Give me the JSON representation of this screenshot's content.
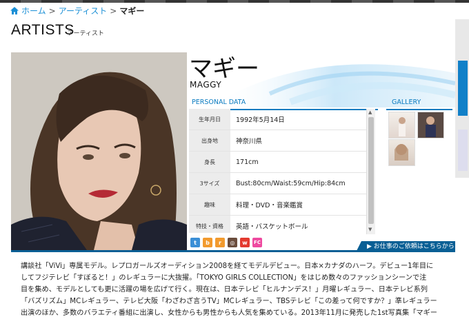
{
  "breadcrumb": {
    "home_label": "ホーム",
    "sep1": ">",
    "artist_label": "アーティスト",
    "sep2": ">",
    "current_label": "マギー"
  },
  "page": {
    "title": "ARTISTS",
    "subtitle": "アーティスト"
  },
  "artist": {
    "name_ja": "マギー",
    "name_en": "MAGGY"
  },
  "personal_data": {
    "heading": "PERSONAL DATA",
    "rows": [
      {
        "label": "生年月日",
        "value": "1992年5月14日"
      },
      {
        "label": "出身地",
        "value": "神奈川県"
      },
      {
        "label": "身長",
        "value": "171cm"
      },
      {
        "label": "3サイズ",
        "value": "Bust:80cm/Waist:59cm/Hip:84cm"
      },
      {
        "label": "趣味",
        "value": "料理・DVD・音楽鑑賞"
      },
      {
        "label": "特技・資格",
        "value": "英語・バスケットボール"
      }
    ]
  },
  "gallery": {
    "heading": "GALLERY",
    "thumbnails": [
      "gallery-thumb-1",
      "gallery-thumb-2",
      "gallery-thumb-3"
    ]
  },
  "social_icons": [
    {
      "name": "twitter-icon",
      "glyph": "t",
      "color": "#3b8fd6"
    },
    {
      "name": "blog-icon",
      "glyph": "b",
      "color": "#f29a2e"
    },
    {
      "name": "rss-icon",
      "glyph": "r",
      "color": "#f29a2e"
    },
    {
      "name": "instagram-icon",
      "glyph": "◎",
      "color": "#6b4d3d"
    },
    {
      "name": "weibo-icon",
      "glyph": "w",
      "color": "#e33a2f"
    },
    {
      "name": "fc-icon",
      "glyph": "FC",
      "color": "#ee4aa0"
    }
  ],
  "contact_link": {
    "label": "▶ お仕事のご依頼はこちらから"
  },
  "bio": {
    "lines": [
      "講談社「ViVi」専属モデル。レプロガールズオーディション2008を経てモデルデビュー。日本×カナダのハーフ。デビュー1年目に",
      "してフジテレビ「すぼると！」のレギュラーに大抜擢。「TOKYO GIRLS COLLECTION」をはじめ数々のファッションシーンで注",
      "目を集め、モデルとしても更に活躍の場を広げて行く。現在は、日本テレビ「ヒルナンデス！」月曜レギュラー、日本テレビ系列",
      "「バズリズム」MCレギュラー、テレビ大阪「わざわざ言うTV」MCレギュラー、TBSテレビ「この差って何ですか？」準レギュラー",
      "出演のほか、多数のバラエティ番組に出演し、女性からも男性からも人気を集めている。2013年11月に発売した1st写真集「マギー"
    ]
  },
  "colors": {
    "accent": "#0a7bc0",
    "link": "#1a8fd6",
    "dark_bar": "#0a5f95"
  }
}
